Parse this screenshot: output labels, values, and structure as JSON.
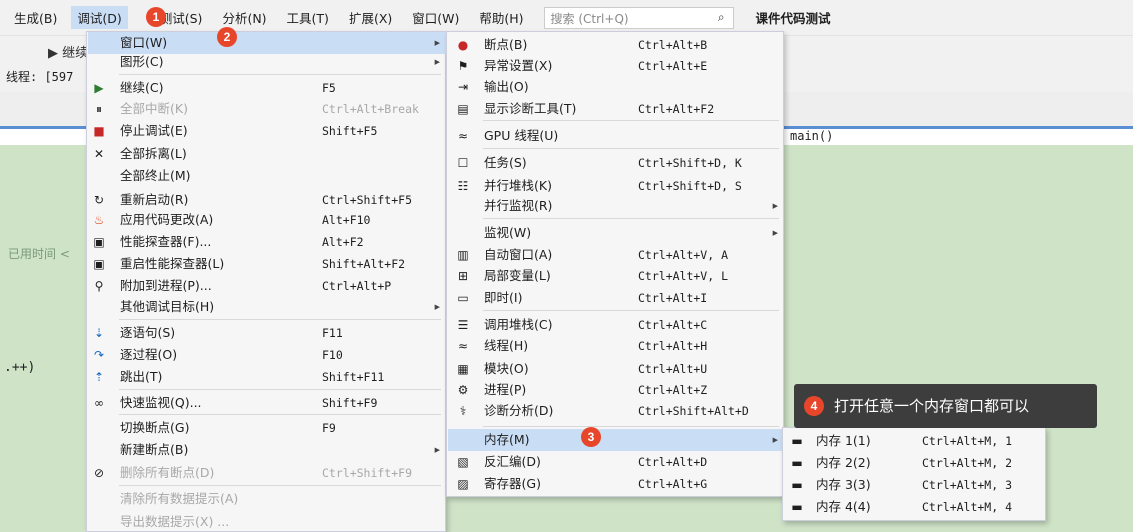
{
  "menubar": {
    "items": [
      "生成(B)",
      "调试(D)",
      "测试(S)",
      "分析(N)",
      "工具(T)",
      "扩展(X)",
      "窗口(W)",
      "帮助(H)"
    ],
    "search_placeholder": "搜索 (Ctrl+Q)",
    "title": "课件代码测试"
  },
  "background": {
    "toolbar_text": "▶ 继续",
    "thread_label": "线程: [597",
    "elapsed_label": "已用时间 <",
    "main_label": "main()",
    "code_fragment": ".++)"
  },
  "debug_menu": {
    "items": [
      {
        "label": "窗口(W)",
        "shortcut": "",
        "icon": "",
        "submenu": true,
        "enabled": true
      },
      {
        "label": "图形(C)",
        "shortcut": "",
        "icon": "",
        "submenu": true,
        "enabled": true
      },
      {
        "label": "继续(C)",
        "shortcut": "F5",
        "icon": "play-icon",
        "enabled": true
      },
      {
        "label": "全部中断(K)",
        "shortcut": "Ctrl+Alt+Break",
        "icon": "pause-icon",
        "enabled": false
      },
      {
        "label": "停止调试(E)",
        "shortcut": "Shift+F5",
        "icon": "stop-icon",
        "enabled": true
      },
      {
        "label": "全部拆离(L)",
        "shortcut": "",
        "icon": "close-icon",
        "enabled": true
      },
      {
        "label": "全部终止(M)",
        "shortcut": "",
        "icon": "",
        "enabled": true
      },
      {
        "label": "重新启动(R)",
        "shortcut": "Ctrl+Shift+F5",
        "icon": "restart-icon",
        "enabled": true
      },
      {
        "label": "应用代码更改(A)",
        "shortcut": "Alt+F10",
        "icon": "flame-icon",
        "enabled": true
      },
      {
        "label": "性能探查器(F)...",
        "shortcut": "Alt+F2",
        "icon": "profiler-icon",
        "enabled": true
      },
      {
        "label": "重启性能探查器(L)",
        "shortcut": "Shift+Alt+F2",
        "icon": "profiler-restart-icon",
        "enabled": true
      },
      {
        "label": "附加到进程(P)...",
        "shortcut": "Ctrl+Alt+P",
        "icon": "attach-icon",
        "enabled": true
      },
      {
        "label": "其他调试目标(H)",
        "shortcut": "",
        "icon": "",
        "submenu": true,
        "enabled": true
      },
      {
        "label": "逐语句(S)",
        "shortcut": "F11",
        "icon": "step-into-icon",
        "enabled": true
      },
      {
        "label": "逐过程(O)",
        "shortcut": "F10",
        "icon": "step-over-icon",
        "enabled": true
      },
      {
        "label": "跳出(T)",
        "shortcut": "Shift+F11",
        "icon": "step-out-icon",
        "enabled": true
      },
      {
        "label": "快速监视(Q)...",
        "shortcut": "Shift+F9",
        "icon": "glasses-icon",
        "enabled": true
      },
      {
        "label": "切换断点(G)",
        "shortcut": "F9",
        "icon": "",
        "enabled": true
      },
      {
        "label": "新建断点(B)",
        "shortcut": "",
        "icon": "",
        "submenu": true,
        "enabled": true
      },
      {
        "label": "删除所有断点(D)",
        "shortcut": "Ctrl+Shift+F9",
        "icon": "delete-breakpoints-icon",
        "enabled": false
      },
      {
        "label": "清除所有数据提示(A)",
        "shortcut": "",
        "icon": "",
        "enabled": false
      },
      {
        "label": "导出数据提示(X) ...",
        "shortcut": "",
        "icon": "",
        "enabled": false
      }
    ]
  },
  "window_menu": {
    "items": [
      {
        "label": "断点(B)",
        "shortcut": "Ctrl+Alt+B",
        "icon": "breakpoint-icon"
      },
      {
        "label": "异常设置(X)",
        "shortcut": "Ctrl+Alt+E",
        "icon": "exception-icon"
      },
      {
        "label": "输出(O)",
        "shortcut": "",
        "icon": "output-icon"
      },
      {
        "label": "显示诊断工具(T)",
        "shortcut": "Ctrl+Alt+F2",
        "icon": "diagnostics-icon"
      },
      {
        "label": "GPU 线程(U)",
        "shortcut": "",
        "icon": "gpu-threads-icon"
      },
      {
        "label": "任务(S)",
        "shortcut": "Ctrl+Shift+D, K",
        "icon": "task-icon"
      },
      {
        "label": "并行堆栈(K)",
        "shortcut": "Ctrl+Shift+D, S",
        "icon": "parallel-stacks-icon"
      },
      {
        "label": "并行监视(R)",
        "shortcut": "",
        "icon": "",
        "submenu": true
      },
      {
        "label": "监视(W)",
        "shortcut": "",
        "icon": "",
        "submenu": true
      },
      {
        "label": "自动窗口(A)",
        "shortcut": "Ctrl+Alt+V, A",
        "icon": "autos-icon"
      },
      {
        "label": "局部变量(L)",
        "shortcut": "Ctrl+Alt+V, L",
        "icon": "locals-icon"
      },
      {
        "label": "即时(I)",
        "shortcut": "Ctrl+Alt+I",
        "icon": "immediate-icon"
      },
      {
        "label": "调用堆栈(C)",
        "shortcut": "Ctrl+Alt+C",
        "icon": "call-stack-icon"
      },
      {
        "label": "线程(H)",
        "shortcut": "Ctrl+Alt+H",
        "icon": "threads-icon"
      },
      {
        "label": "模块(O)",
        "shortcut": "Ctrl+Alt+U",
        "icon": "modules-icon"
      },
      {
        "label": "进程(P)",
        "shortcut": "Ctrl+Alt+Z",
        "icon": "processes-icon"
      },
      {
        "label": "诊断分析(D)",
        "shortcut": "Ctrl+Shift+Alt+D",
        "icon": "diagnostic-analysis-icon"
      },
      {
        "label": "内存(M)",
        "shortcut": "",
        "icon": "",
        "submenu": true
      },
      {
        "label": "反汇编(D)",
        "shortcut": "Ctrl+Alt+D",
        "icon": "disassembly-icon"
      },
      {
        "label": "寄存器(G)",
        "shortcut": "Ctrl+Alt+G",
        "icon": "registers-icon"
      }
    ]
  },
  "memory_menu": {
    "items": [
      {
        "label": "内存 1(1)",
        "shortcut": "Ctrl+Alt+M, 1",
        "icon": "memory-icon"
      },
      {
        "label": "内存 2(2)",
        "shortcut": "Ctrl+Alt+M, 2",
        "icon": "memory-icon"
      },
      {
        "label": "内存 3(3)",
        "shortcut": "Ctrl+Alt+M, 3",
        "icon": "memory-icon"
      },
      {
        "label": "内存 4(4)",
        "shortcut": "Ctrl+Alt+M, 4",
        "icon": "memory-icon"
      }
    ]
  },
  "annotations": {
    "badges": [
      "1",
      "2",
      "3",
      "4"
    ],
    "tooltip": "打开任意一个内存窗口都可以"
  },
  "colors": {
    "highlight": "#c9def5",
    "badge": "#e8462b",
    "editor_bg": "#cfe3c7",
    "tooltip_bg": "#3d3d3d"
  }
}
